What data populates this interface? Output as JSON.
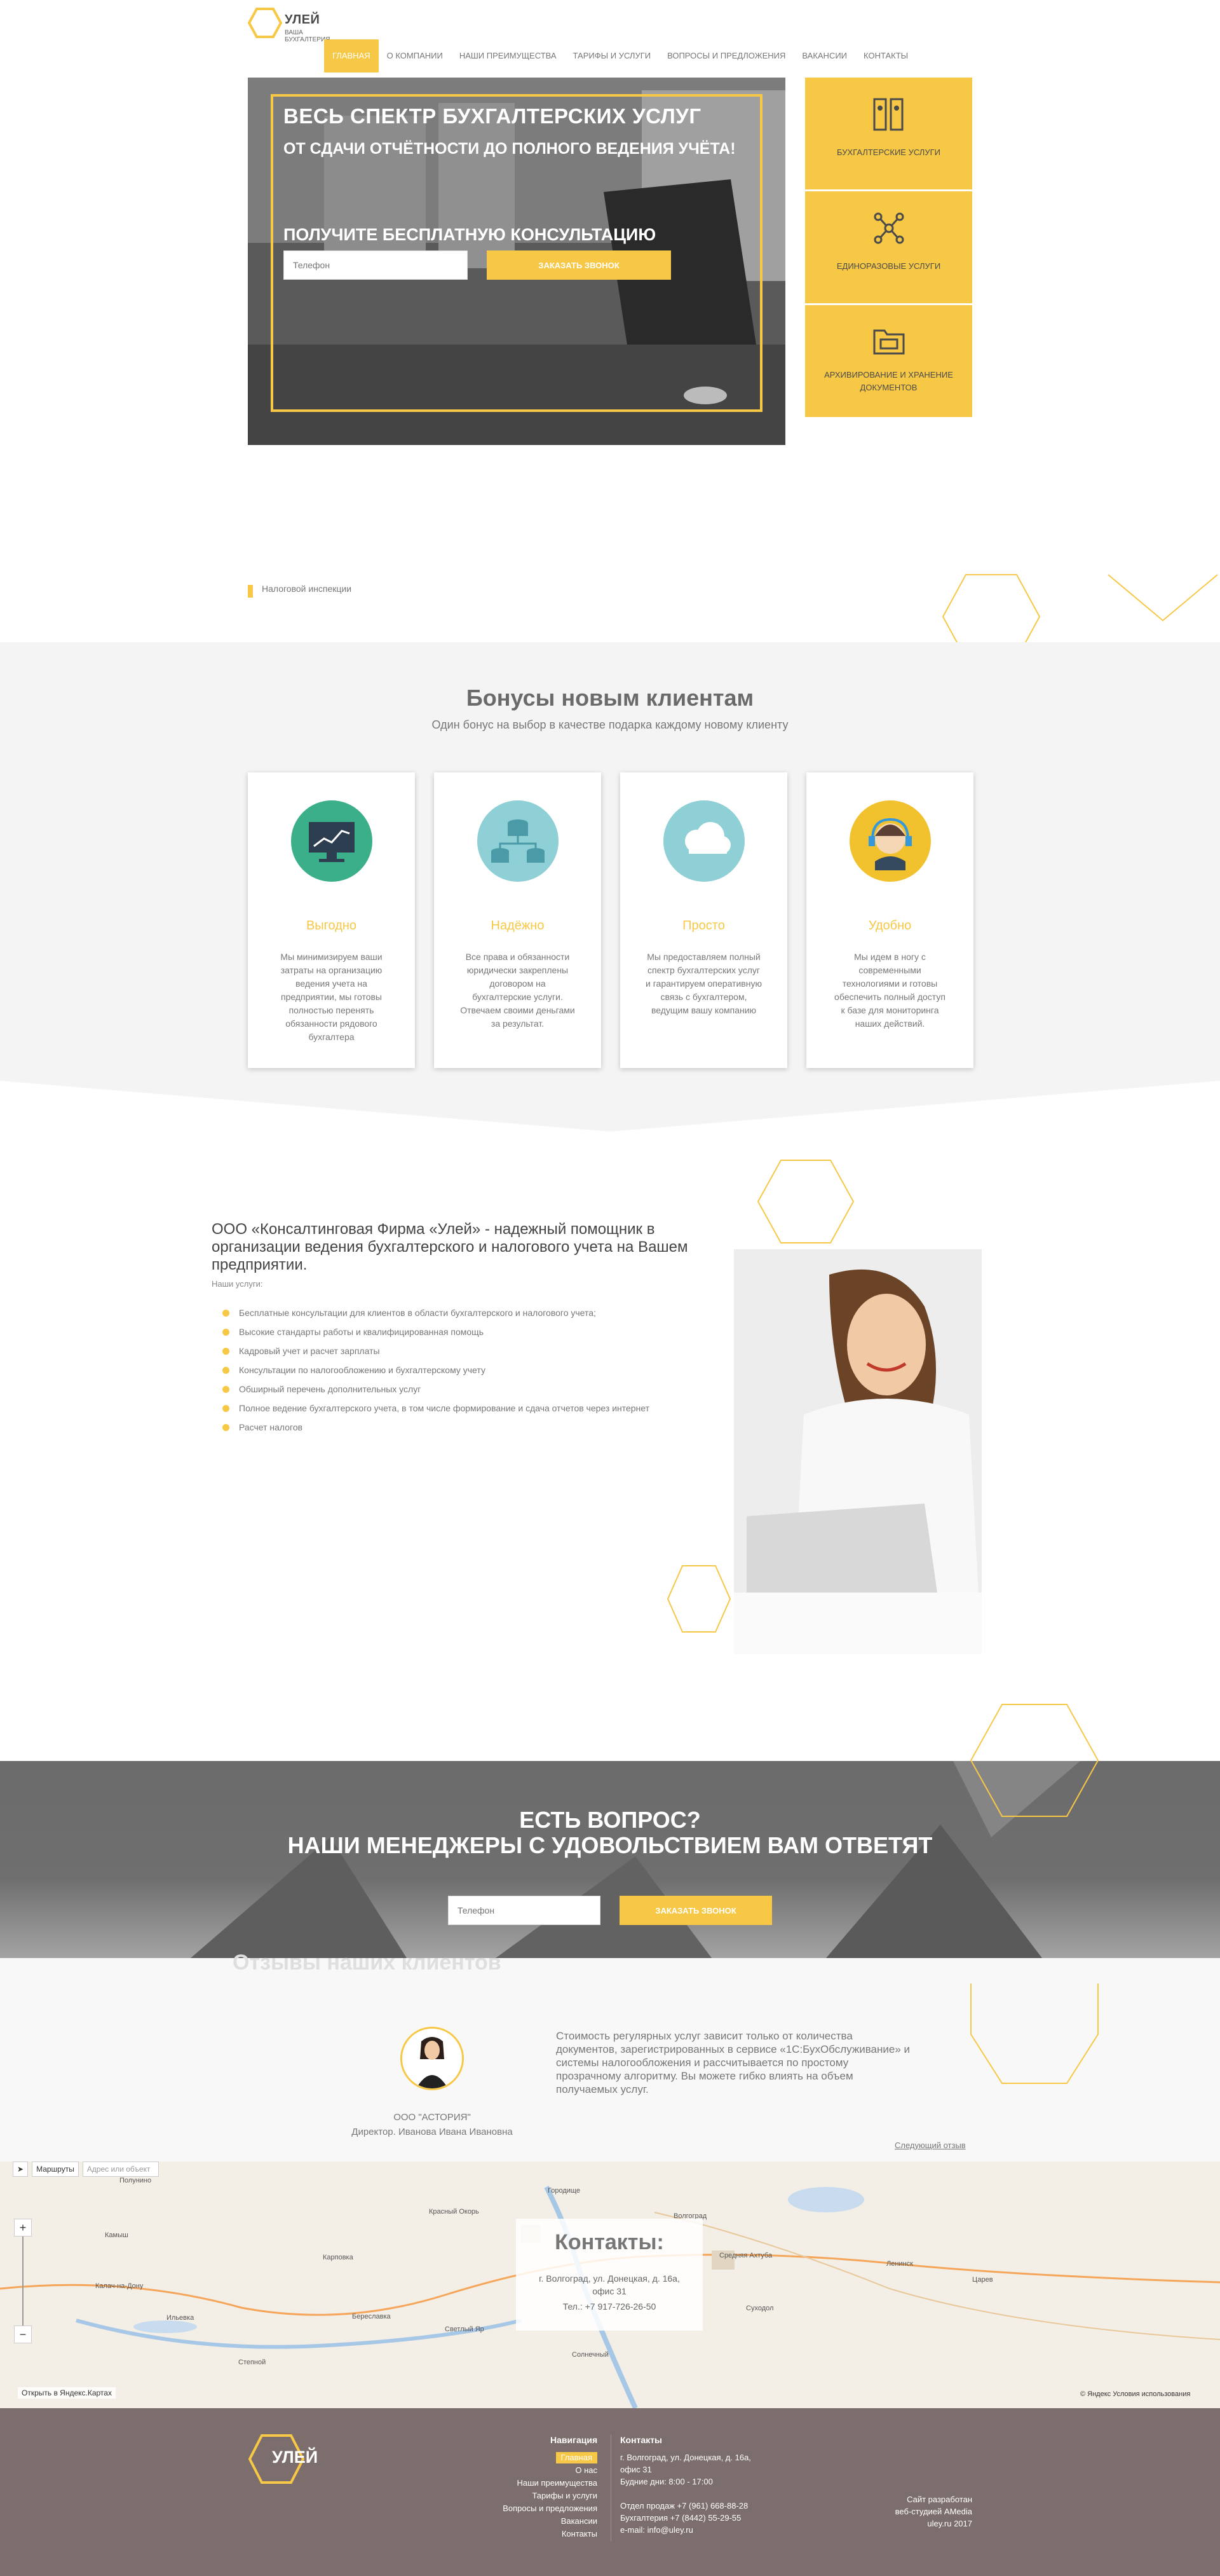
{
  "colors": {
    "accent": "#f7c846",
    "text": "#555555",
    "footer_bg": "#7b6e6c"
  },
  "header": {
    "logo_title": "УЛЕЙ",
    "logo_subtitle": "ВАША БУХГАЛТЕРИЯ",
    "nav": [
      "ГЛАВНАЯ",
      "О КОМПАНИИ",
      "НАШИ ПРЕИМУЩЕСТВА",
      "ТАРИФЫ И УСЛУГИ",
      "ВОПРОСЫ И ПРЕДЛОЖЕНИЯ",
      "ВАКАНСИИ",
      "КОНТАКТЫ"
    ]
  },
  "hero": {
    "title": "ВЕСЬ СПЕКТР БУХГАЛТЕРСКИХ УСЛУГ",
    "subtitle": "ОТ СДАЧИ ОТЧЁТНОСТИ ДО ПОЛНОГО ВЕДЕНИЯ УЧЁТА!",
    "cta": "ПОЛУЧИТЕ БЕСПЛАТНУЮ КОНСУЛЬТАЦИЮ",
    "phone_placeholder": "Телефон",
    "button": "ЗАКАЗАТЬ ЗВОНОК"
  },
  "tiles": [
    {
      "label": "БУХГАЛТЕРСКИЕ УСЛУГИ",
      "icon": "binders-icon"
    },
    {
      "label": "ЕДИНОРАЗОВЫЕ УСЛУГИ",
      "icon": "network-icon"
    },
    {
      "label": "АРХИВИРОВАНИЕ И ХРАНЕНИЕ ДОКУМЕНТОВ",
      "icon": "archive-box-icon"
    }
  ],
  "truncated_item": "Налоговой инспекции",
  "bonus": {
    "title": "Бонусы новым клиентам",
    "subtitle": "Один бонус на выбор в качестве подарка каждому новому клиенту",
    "cards": [
      {
        "title": "Выгодно",
        "text": "Мы минимизируем ваши затраты на организацию ведения учета на предприятии, мы готовы полностью перенять обязанности рядового бухгалтера",
        "icon": "monitor-chart-icon",
        "color": "#3aaf8a"
      },
      {
        "title": "Надёжно",
        "text": "Все права и обязанности юридически закреплены договором на бухгалтерские услуги. Отвечаем своими деньгами за результат.",
        "icon": "database-icon",
        "color": "#8fcfd6"
      },
      {
        "title": "Просто",
        "text": "Мы предоставляем полный спектр бухгалтерских услуг и гарантируем оперативную связь с бухгалтером, ведущим вашу компанию",
        "icon": "cloud-icon",
        "color": "#8fcfd6"
      },
      {
        "title": "Удобно",
        "text": "Мы идем в ногу с современными технологиями и готовы обеспечить полный доступ к базе для мониторинга наших действий.",
        "icon": "support-agent-icon",
        "color": "#f2c12e"
      }
    ]
  },
  "about": {
    "title": "ООО «Консалтинговая Фирма «Улей» - надежный помощник в организации ведения бухгалтерского и налогового учета на Вашем предприятии.",
    "sub": "Наши услуги:",
    "items": [
      "Бесплатные консультации для клиентов в области бухгалтерского и налогового учета;",
      "Высокие стандарты работы и квалифицированная помощь",
      "Кадровый учет и расчет зарплаты",
      "Консультации по налогообложению и бухгалтерскому учету",
      "Обширный перечень дополнительных услуг",
      "Полное ведение бухгалтерского учета, в том числе формирование и сдача отчетов через интернет",
      "Расчет налогов"
    ]
  },
  "question": {
    "line1": "ЕСТЬ ВОПРОС?",
    "line2": "НАШИ МЕНЕДЖЕРЫ С УДОВОЛЬСТВИЕМ ВАМ ОТВЕТЯТ",
    "phone_placeholder": "Телефон",
    "button": "ЗАКАЗАТЬ ЗВОНОК"
  },
  "reviews": {
    "title": "Отзывы наших клиентов",
    "company": "ООО \"АСТОРИЯ\"",
    "person": "Директор. Иванова Ивана Ивановна",
    "text": "Стоимость регулярных услуг зависит только от количества документов, зарегистрированных в сервисе «1С:БухОбслуживание» и системы налогообложения и рассчитывается по простому прозрачному алгоритму. Вы можете гибко влиять на объем получаемых услуг.",
    "next": "Следующий отзыв"
  },
  "map": {
    "route_button": "Маршруты",
    "address_hint": "Адрес или объект",
    "open_link": "Открыть в Яндекс.Картах",
    "copyright": "© Яндекс Условия использования",
    "cities": [
      "Красный Окорь",
      "Городище",
      "Волгоград",
      "Средняя Ахтуба",
      "Ленинск",
      "Калач-на-Дону",
      "Карповка",
      "Камыш",
      "Ильевка",
      "Береславка",
      "Светлый Яр",
      "Полунино",
      "Степной",
      "Солнечный",
      "Суходол",
      "Царев"
    ],
    "contact_title": "Контакты:",
    "contact_address": "г. Волгоград, ул. Донецкая, д. 16а, офис 31",
    "contact_phone": "Тел.: +7 917-726-26-50"
  },
  "footer": {
    "logo": "УЛЕЙ",
    "nav_title": "Навигация",
    "nav": [
      "Главная",
      "О нас",
      "Наши преимущества",
      "Тарифы и услуги",
      "Вопросы и предложения",
      "Вакансии",
      "Контакты"
    ],
    "contacts_title": "Контакты",
    "contacts": [
      "г. Волгоград, ул. Донецкая, д. 16а,",
      "офис 31",
      "Будние дни: 8:00 - 17:00",
      "",
      "Отдел продаж +7 (961) 668-88-28",
      "Бухгалтерия +7 (8442) 55-29-55",
      "e-mail: info@uley.ru"
    ],
    "dev": [
      "Сайт разработан",
      "веб-студией AMedia",
      "uley.ru 2017"
    ]
  }
}
